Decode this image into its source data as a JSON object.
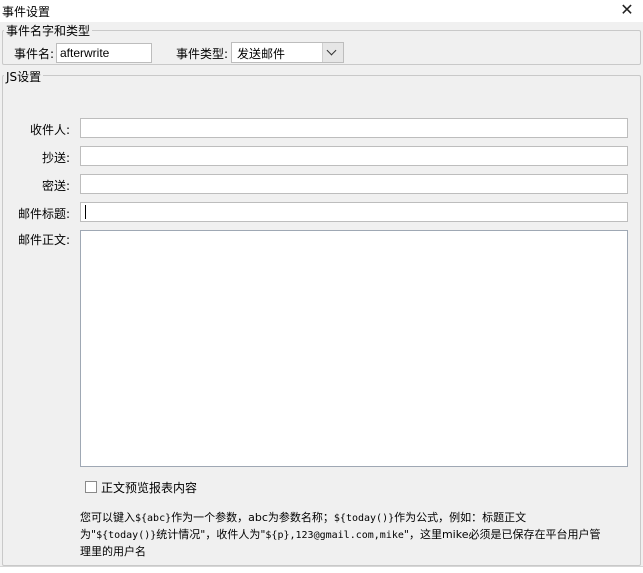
{
  "window": {
    "title": "事件设置",
    "close_glyph": "✕"
  },
  "event_group": {
    "legend": "事件名字和类型",
    "name_label": "事件名:",
    "name_value": "afterwrite",
    "type_label": "事件类型:",
    "type_value": "发送邮件"
  },
  "js_group": {
    "legend": "JS设置",
    "to_label": "收件人:",
    "to_value": "",
    "cc_label": "抄送:",
    "cc_value": "",
    "bcc_label": "密送:",
    "bcc_value": "",
    "subject_label": "邮件标题:",
    "subject_value": "",
    "body_label": "邮件正文:",
    "body_value": ""
  },
  "preview_checkbox": {
    "label": "正文预览报表内容",
    "checked": false
  },
  "help": {
    "line1_a": "您可以键入",
    "line1_code1": "${abc}",
    "line1_b": "作为一个参数，abc为参数名称；",
    "line1_code2": "${today()}",
    "line1_c": "作为公式，例如：标题正文",
    "line2_a": "为\"",
    "line2_code1": "${today()}",
    "line2_b": "统计情况\"，收件人为\"",
    "line2_code2": "${p},123@gmail.com,mike",
    "line2_c": "\"，这里mike必须是已保存在平台用户管",
    "line3": "理里的用户名"
  }
}
